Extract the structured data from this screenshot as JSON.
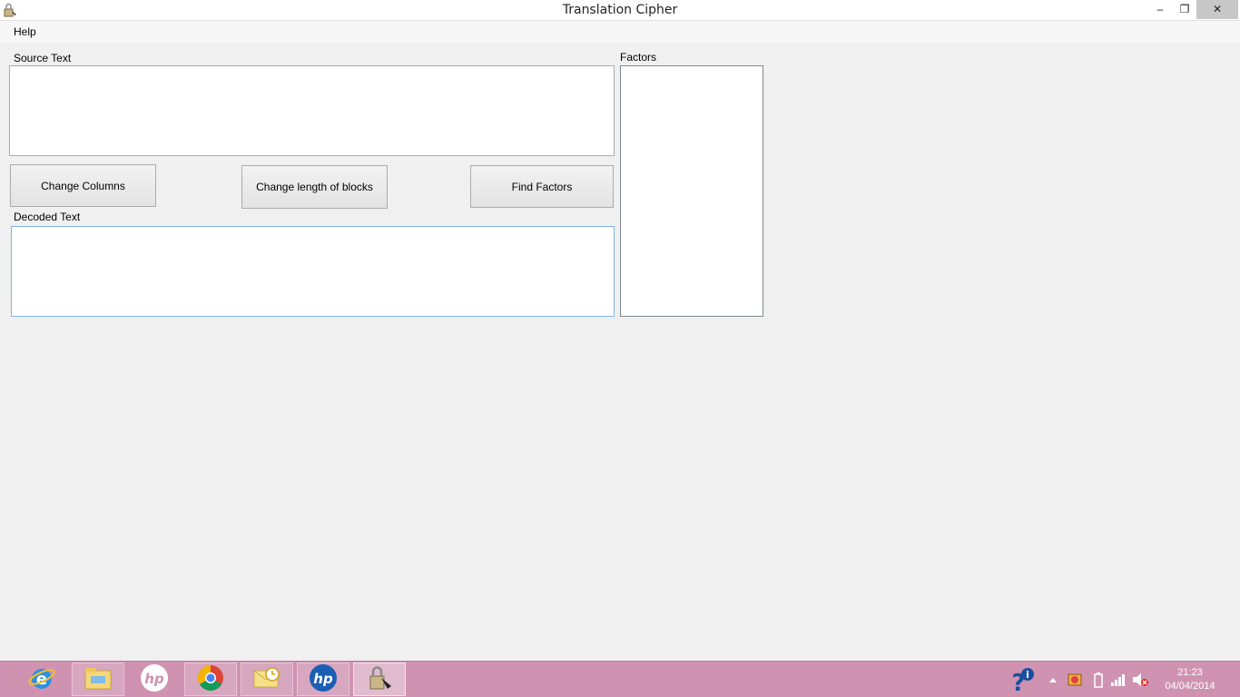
{
  "window": {
    "title": "Translation Cipher",
    "minimize": "–",
    "maximize": "❐",
    "close": "✕"
  },
  "menu": {
    "help": "Help"
  },
  "form": {
    "source_label": "Source Text",
    "source_value": "",
    "decoded_label": "Decoded Text",
    "decoded_value": "",
    "factors_label": "Factors",
    "buttons": {
      "change_columns": "Change Columns",
      "change_length": "Change length of blocks",
      "find_factors": "Find Factors"
    }
  },
  "taskbar": {
    "apps": [
      {
        "name": "internet-explorer-icon"
      },
      {
        "name": "file-explorer-icon"
      },
      {
        "name": "hp-icon"
      },
      {
        "name": "chrome-icon"
      },
      {
        "name": "outlook-icon"
      },
      {
        "name": "hp-support-icon"
      },
      {
        "name": "translation-cipher-icon"
      }
    ],
    "clock": {
      "time": "21:23",
      "date": "04/04/2014"
    },
    "colors": {
      "background": "#cf93b1"
    }
  }
}
